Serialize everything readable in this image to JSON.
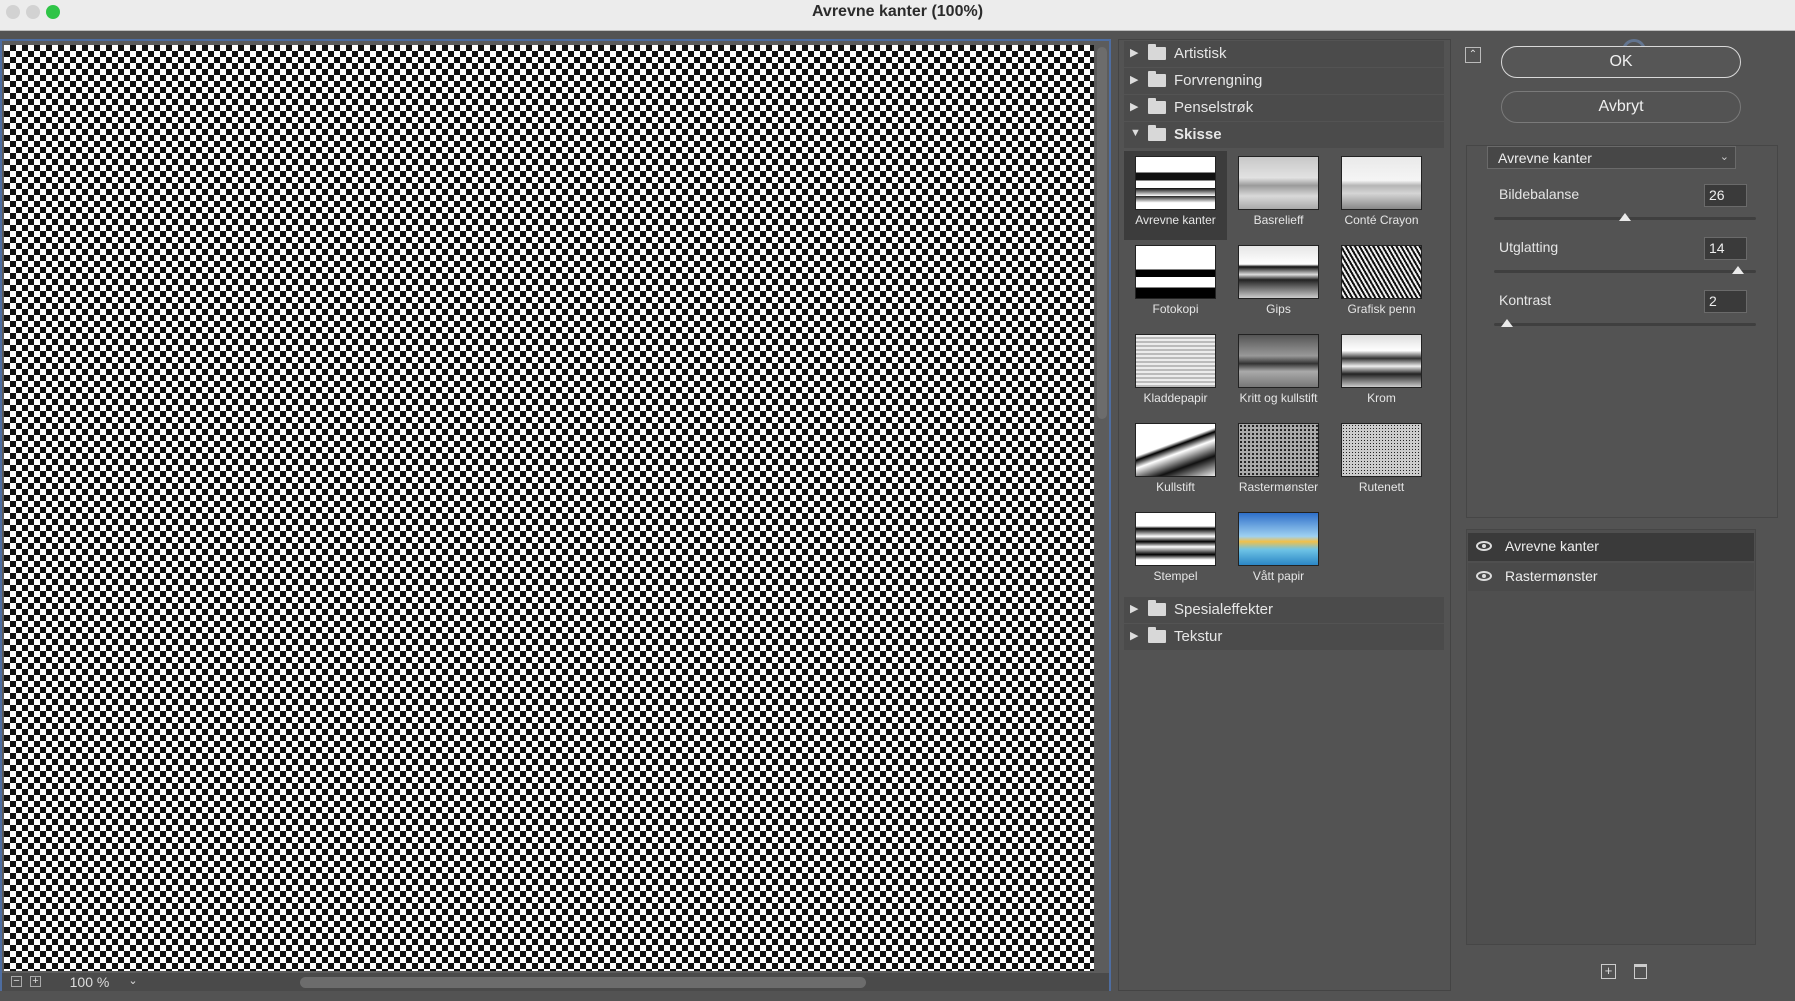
{
  "window": {
    "title": "Avrevne kanter (100%)"
  },
  "preview": {
    "zoom": "100 %"
  },
  "filter_gallery": {
    "categories_top": [
      {
        "label": "Artistisk",
        "expanded": false
      },
      {
        "label": "Forvrengning",
        "expanded": false
      },
      {
        "label": "Penselstrøk",
        "expanded": false
      },
      {
        "label": "Skisse",
        "expanded": true
      }
    ],
    "skisse_filters": [
      {
        "label": "Avrevne kanter",
        "selected": true
      },
      {
        "label": "Basrelieff"
      },
      {
        "label": "Conté Crayon"
      },
      {
        "label": "Fotokopi"
      },
      {
        "label": "Gips"
      },
      {
        "label": "Grafisk penn"
      },
      {
        "label": "Kladdepapir"
      },
      {
        "label": "Kritt og kullstift"
      },
      {
        "label": "Krom"
      },
      {
        "label": "Kullstift"
      },
      {
        "label": "Rastermønster"
      },
      {
        "label": "Rutenett"
      },
      {
        "label": "Stempel"
      },
      {
        "label": "Vått papir"
      }
    ],
    "categories_bottom": [
      {
        "label": "Spesialeffekter",
        "expanded": false
      },
      {
        "label": "Tekstur",
        "expanded": false
      }
    ]
  },
  "actions": {
    "ok": "OK",
    "cancel": "Avbryt"
  },
  "settings": {
    "filter_select": "Avrevne kanter",
    "params": [
      {
        "label": "Bildebalanse",
        "value": "26",
        "level": 0.5
      },
      {
        "label": "Utglatting",
        "value": "14",
        "level": 0.93
      },
      {
        "label": "Kontrast",
        "value": "2",
        "level": 0.05
      }
    ]
  },
  "layers": [
    {
      "label": "Avrevne kanter",
      "active": true
    },
    {
      "label": "Rastermønster",
      "active": false
    }
  ],
  "icons": {
    "collapse": "collapse-panel-icon",
    "new_layer": "new-effect-layer-icon",
    "delete": "trash-icon",
    "visibility": "eye-icon"
  }
}
